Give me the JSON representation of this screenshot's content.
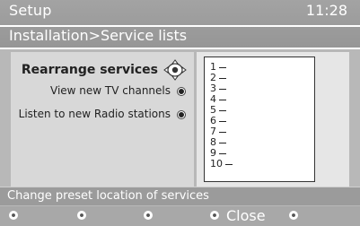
{
  "header": {
    "title": "Setup",
    "clock": "11:28",
    "breadcrumb": "Installation>Service lists"
  },
  "menu": {
    "items": [
      {
        "label": "Rearrange services",
        "selected": true
      },
      {
        "label": "View new TV channels",
        "selected": false
      },
      {
        "label": "Listen to new Radio stations",
        "selected": false
      }
    ]
  },
  "preset_list": {
    "rows": [
      "1",
      "2",
      "3",
      "4",
      "5",
      "6",
      "7",
      "8",
      "9",
      "10"
    ]
  },
  "info": {
    "hint": "Change preset location of services"
  },
  "footer": {
    "keys": [
      {
        "label": "",
        "icon": "color-key-icon"
      },
      {
        "label": "",
        "icon": "color-key-icon"
      },
      {
        "label": "",
        "icon": "color-key-icon"
      },
      {
        "label": "Close",
        "icon": "color-key-icon"
      },
      {
        "label": "",
        "icon": "color-key-icon"
      }
    ]
  },
  "colors": {
    "background": "#b8b8b8",
    "header": "#9b9b9b",
    "panel": "#d8d8d8",
    "text_dark": "#222222",
    "text_light": "#ffffff"
  }
}
